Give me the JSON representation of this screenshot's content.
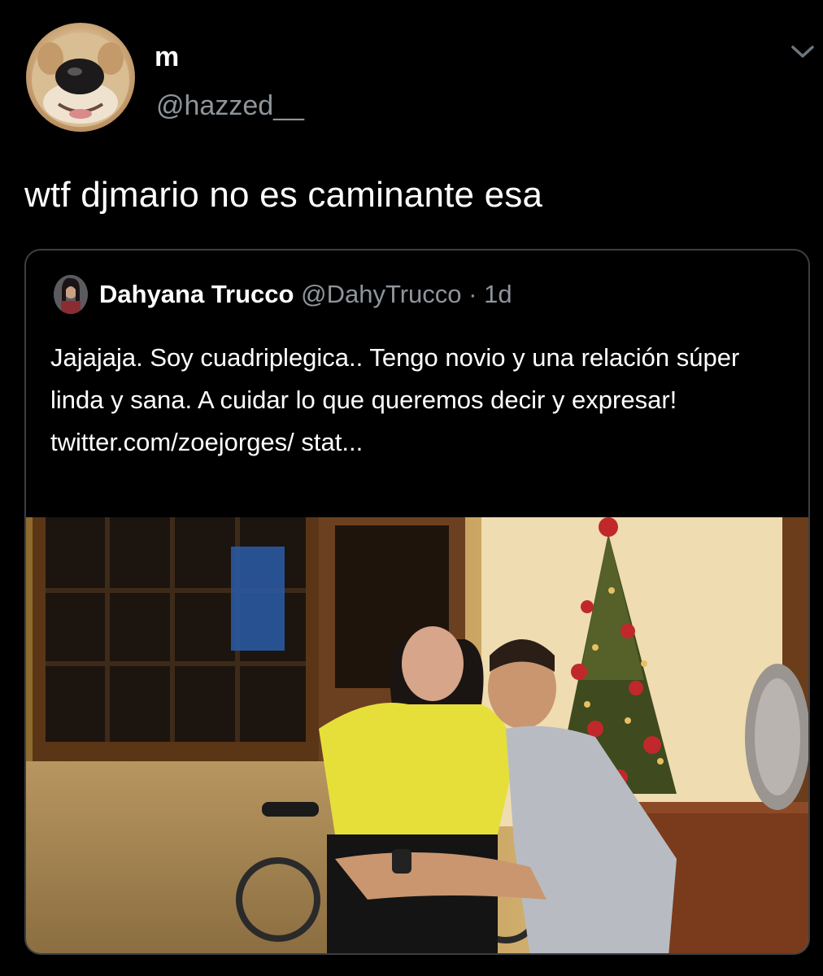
{
  "tweet": {
    "author": {
      "display_name": "m",
      "handle": "@hazzed__"
    },
    "text": "wtf djmario no es caminante esa"
  },
  "quoted_tweet": {
    "author": {
      "display_name": "Dahyana Trucco",
      "handle": "@DahyTrucco"
    },
    "meta": "@DahyTrucco · 1d",
    "text": "Jajajaja. Soy cuadriplegica.. Tengo novio y una relación súper linda y sana. A cuidar lo que queremos decir y expresar! twitter.com/zoejorges/ stat..."
  },
  "icons": {
    "menu": "chevron-down-icon"
  },
  "colors": {
    "background": "#000000",
    "text_primary": "#ffffff",
    "text_secondary": "#8e959b",
    "border": "#3a3f45"
  }
}
